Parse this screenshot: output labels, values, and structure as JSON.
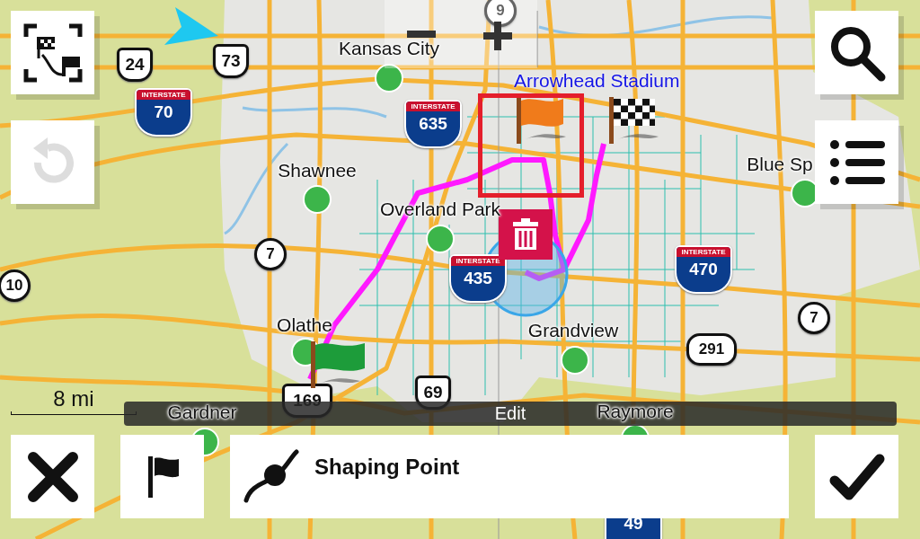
{
  "map": {
    "places": [
      {
        "name": "Kansas City"
      },
      {
        "name": "Shawnee"
      },
      {
        "name": "Overland Park"
      },
      {
        "name": "Blue Sp"
      },
      {
        "name": "Olathe"
      },
      {
        "name": "Grandview"
      },
      {
        "name": "Gardner"
      },
      {
        "name": "Raymore"
      }
    ],
    "landmark": "Arrowhead Stadium",
    "shields": [
      {
        "kind": "us",
        "number": "24"
      },
      {
        "kind": "us",
        "number": "73"
      },
      {
        "kind": "interstate",
        "banner": "INTERSTATE",
        "number": "70"
      },
      {
        "kind": "interstate",
        "banner": "INTERSTATE",
        "number": "635"
      },
      {
        "kind": "interstate",
        "banner": "INTERSTATE",
        "number": "435"
      },
      {
        "kind": "interstate",
        "banner": "INTERSTATE",
        "number": "470"
      },
      {
        "kind": "interstate",
        "number": "49"
      },
      {
        "kind": "state",
        "number": "7"
      },
      {
        "kind": "state",
        "number": "10"
      },
      {
        "kind": "state",
        "number": "7"
      },
      {
        "kind": "state",
        "number": "291"
      },
      {
        "kind": "state",
        "number": "9"
      },
      {
        "kind": "us",
        "number": "169"
      },
      {
        "kind": "us",
        "number": "69"
      }
    ],
    "route_points": [
      {
        "kind": "start",
        "selected": false
      },
      {
        "kind": "shaping",
        "selected": true
      },
      {
        "kind": "finish",
        "selected": false
      }
    ],
    "scale": "8 mi"
  },
  "undo": {
    "disabled": true
  },
  "mode_bar": {
    "label": "Edit"
  },
  "point_panel": {
    "label": "Shaping Point"
  }
}
